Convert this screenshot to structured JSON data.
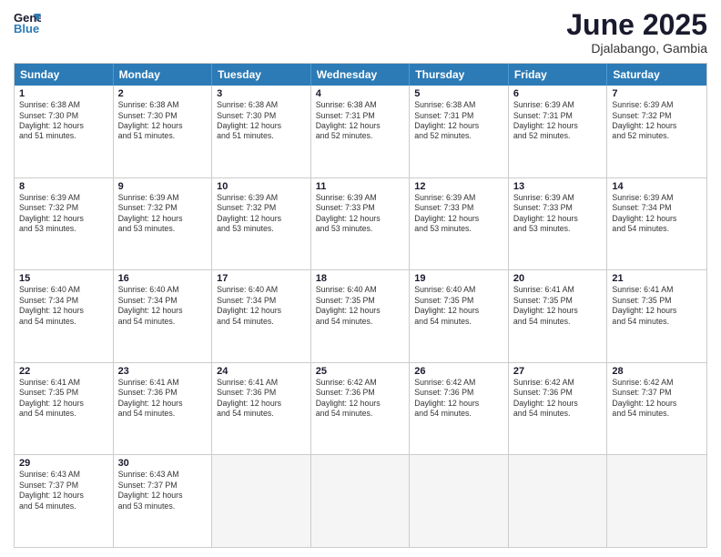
{
  "header": {
    "logo_line1": "General",
    "logo_line2": "Blue",
    "month": "June 2025",
    "location": "Djalabango, Gambia"
  },
  "days_of_week": [
    "Sunday",
    "Monday",
    "Tuesday",
    "Wednesday",
    "Thursday",
    "Friday",
    "Saturday"
  ],
  "weeks": [
    [
      {
        "day": "1",
        "text": "Sunrise: 6:38 AM\nSunset: 7:30 PM\nDaylight: 12 hours\nand 51 minutes."
      },
      {
        "day": "2",
        "text": "Sunrise: 6:38 AM\nSunset: 7:30 PM\nDaylight: 12 hours\nand 51 minutes."
      },
      {
        "day": "3",
        "text": "Sunrise: 6:38 AM\nSunset: 7:30 PM\nDaylight: 12 hours\nand 51 minutes."
      },
      {
        "day": "4",
        "text": "Sunrise: 6:38 AM\nSunset: 7:31 PM\nDaylight: 12 hours\nand 52 minutes."
      },
      {
        "day": "5",
        "text": "Sunrise: 6:38 AM\nSunset: 7:31 PM\nDaylight: 12 hours\nand 52 minutes."
      },
      {
        "day": "6",
        "text": "Sunrise: 6:39 AM\nSunset: 7:31 PM\nDaylight: 12 hours\nand 52 minutes."
      },
      {
        "day": "7",
        "text": "Sunrise: 6:39 AM\nSunset: 7:32 PM\nDaylight: 12 hours\nand 52 minutes."
      }
    ],
    [
      {
        "day": "8",
        "text": "Sunrise: 6:39 AM\nSunset: 7:32 PM\nDaylight: 12 hours\nand 53 minutes."
      },
      {
        "day": "9",
        "text": "Sunrise: 6:39 AM\nSunset: 7:32 PM\nDaylight: 12 hours\nand 53 minutes."
      },
      {
        "day": "10",
        "text": "Sunrise: 6:39 AM\nSunset: 7:32 PM\nDaylight: 12 hours\nand 53 minutes."
      },
      {
        "day": "11",
        "text": "Sunrise: 6:39 AM\nSunset: 7:33 PM\nDaylight: 12 hours\nand 53 minutes."
      },
      {
        "day": "12",
        "text": "Sunrise: 6:39 AM\nSunset: 7:33 PM\nDaylight: 12 hours\nand 53 minutes."
      },
      {
        "day": "13",
        "text": "Sunrise: 6:39 AM\nSunset: 7:33 PM\nDaylight: 12 hours\nand 53 minutes."
      },
      {
        "day": "14",
        "text": "Sunrise: 6:39 AM\nSunset: 7:34 PM\nDaylight: 12 hours\nand 54 minutes."
      }
    ],
    [
      {
        "day": "15",
        "text": "Sunrise: 6:40 AM\nSunset: 7:34 PM\nDaylight: 12 hours\nand 54 minutes."
      },
      {
        "day": "16",
        "text": "Sunrise: 6:40 AM\nSunset: 7:34 PM\nDaylight: 12 hours\nand 54 minutes."
      },
      {
        "day": "17",
        "text": "Sunrise: 6:40 AM\nSunset: 7:34 PM\nDaylight: 12 hours\nand 54 minutes."
      },
      {
        "day": "18",
        "text": "Sunrise: 6:40 AM\nSunset: 7:35 PM\nDaylight: 12 hours\nand 54 minutes."
      },
      {
        "day": "19",
        "text": "Sunrise: 6:40 AM\nSunset: 7:35 PM\nDaylight: 12 hours\nand 54 minutes."
      },
      {
        "day": "20",
        "text": "Sunrise: 6:41 AM\nSunset: 7:35 PM\nDaylight: 12 hours\nand 54 minutes."
      },
      {
        "day": "21",
        "text": "Sunrise: 6:41 AM\nSunset: 7:35 PM\nDaylight: 12 hours\nand 54 minutes."
      }
    ],
    [
      {
        "day": "22",
        "text": "Sunrise: 6:41 AM\nSunset: 7:35 PM\nDaylight: 12 hours\nand 54 minutes."
      },
      {
        "day": "23",
        "text": "Sunrise: 6:41 AM\nSunset: 7:36 PM\nDaylight: 12 hours\nand 54 minutes."
      },
      {
        "day": "24",
        "text": "Sunrise: 6:41 AM\nSunset: 7:36 PM\nDaylight: 12 hours\nand 54 minutes."
      },
      {
        "day": "25",
        "text": "Sunrise: 6:42 AM\nSunset: 7:36 PM\nDaylight: 12 hours\nand 54 minutes."
      },
      {
        "day": "26",
        "text": "Sunrise: 6:42 AM\nSunset: 7:36 PM\nDaylight: 12 hours\nand 54 minutes."
      },
      {
        "day": "27",
        "text": "Sunrise: 6:42 AM\nSunset: 7:36 PM\nDaylight: 12 hours\nand 54 minutes."
      },
      {
        "day": "28",
        "text": "Sunrise: 6:42 AM\nSunset: 7:37 PM\nDaylight: 12 hours\nand 54 minutes."
      }
    ],
    [
      {
        "day": "29",
        "text": "Sunrise: 6:43 AM\nSunset: 7:37 PM\nDaylight: 12 hours\nand 54 minutes."
      },
      {
        "day": "30",
        "text": "Sunrise: 6:43 AM\nSunset: 7:37 PM\nDaylight: 12 hours\nand 53 minutes."
      },
      {
        "day": "",
        "text": ""
      },
      {
        "day": "",
        "text": ""
      },
      {
        "day": "",
        "text": ""
      },
      {
        "day": "",
        "text": ""
      },
      {
        "day": "",
        "text": ""
      }
    ]
  ]
}
